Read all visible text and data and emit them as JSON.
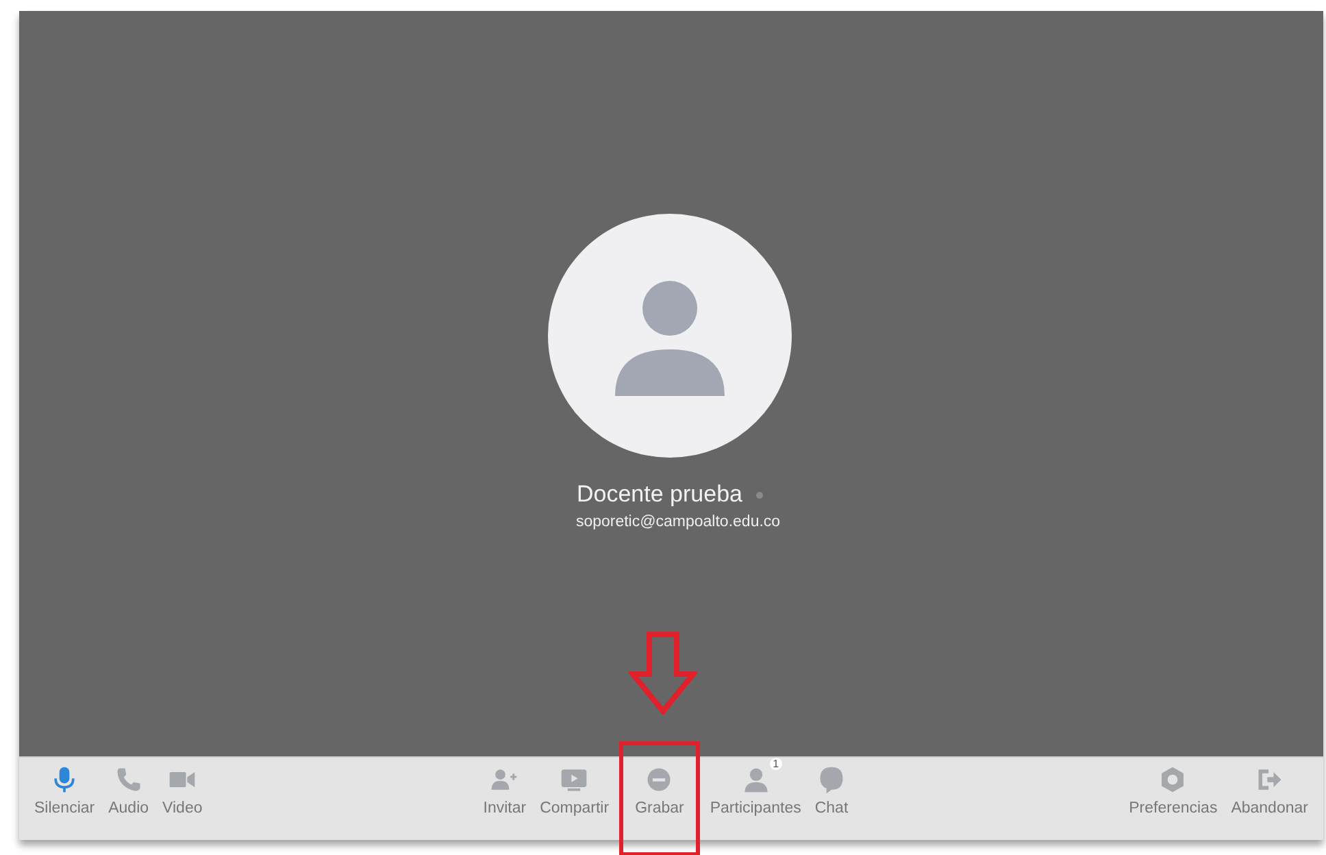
{
  "participant": {
    "name": "Docente prueba",
    "email": "soporetic@campoalto.edu.co",
    "online": false
  },
  "toolbar": {
    "groups": [
      [
        {
          "label": "Silenciar",
          "kind": "mic",
          "active": true
        },
        {
          "label": "Audio",
          "kind": "phone",
          "active": false
        },
        {
          "label": "Video",
          "kind": "camera",
          "active": false
        }
      ],
      [
        {
          "label": "Invitar",
          "kind": "invite",
          "active": false
        },
        {
          "label": "Compartir",
          "kind": "screen",
          "active": false
        },
        {
          "label": "Grabar",
          "kind": "record",
          "active": false,
          "highlighted": true
        },
        {
          "label": "Participantes",
          "kind": "person",
          "active": false,
          "badge": "1"
        },
        {
          "label": "Chat",
          "kind": "chat",
          "active": false
        }
      ],
      [
        {
          "label": "Preferencias",
          "kind": "gear",
          "active": false
        },
        {
          "label": "Abandonar",
          "kind": "exit",
          "active": false
        }
      ]
    ]
  }
}
